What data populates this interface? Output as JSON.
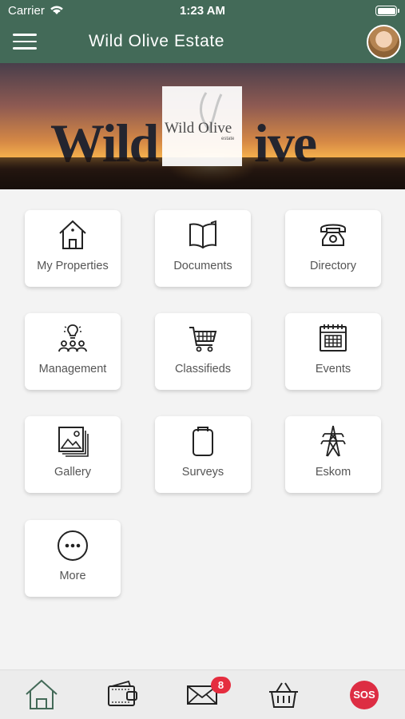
{
  "status_bar": {
    "carrier": "Carrier",
    "time": "1:23 AM"
  },
  "header": {
    "title": "Wild Olive Estate"
  },
  "banner": {
    "logo_text": "Wild Olive",
    "logo_sub": "estate",
    "sign_left": "Wild",
    "sign_right": "ive"
  },
  "tiles": [
    {
      "label": "My Properties",
      "icon": "house-icon"
    },
    {
      "label": "Documents",
      "icon": "book-icon"
    },
    {
      "label": "Directory",
      "icon": "telephone-icon"
    },
    {
      "label": "Management",
      "icon": "management-icon"
    },
    {
      "label": "Classifieds",
      "icon": "shopping-cart-icon"
    },
    {
      "label": "Events",
      "icon": "calendar-icon"
    },
    {
      "label": "Gallery",
      "icon": "gallery-icon"
    },
    {
      "label": "Surveys",
      "icon": "clipboard-icon"
    },
    {
      "label": "Eskom",
      "icon": "power-tower-icon"
    },
    {
      "label": "More",
      "icon": "more-icon"
    }
  ],
  "bottom_nav": {
    "messages_badge": "8",
    "sos_label": "SOS"
  },
  "colors": {
    "header": "#436a58",
    "sos": "#dd2d43",
    "badge": "#e52d3f"
  }
}
